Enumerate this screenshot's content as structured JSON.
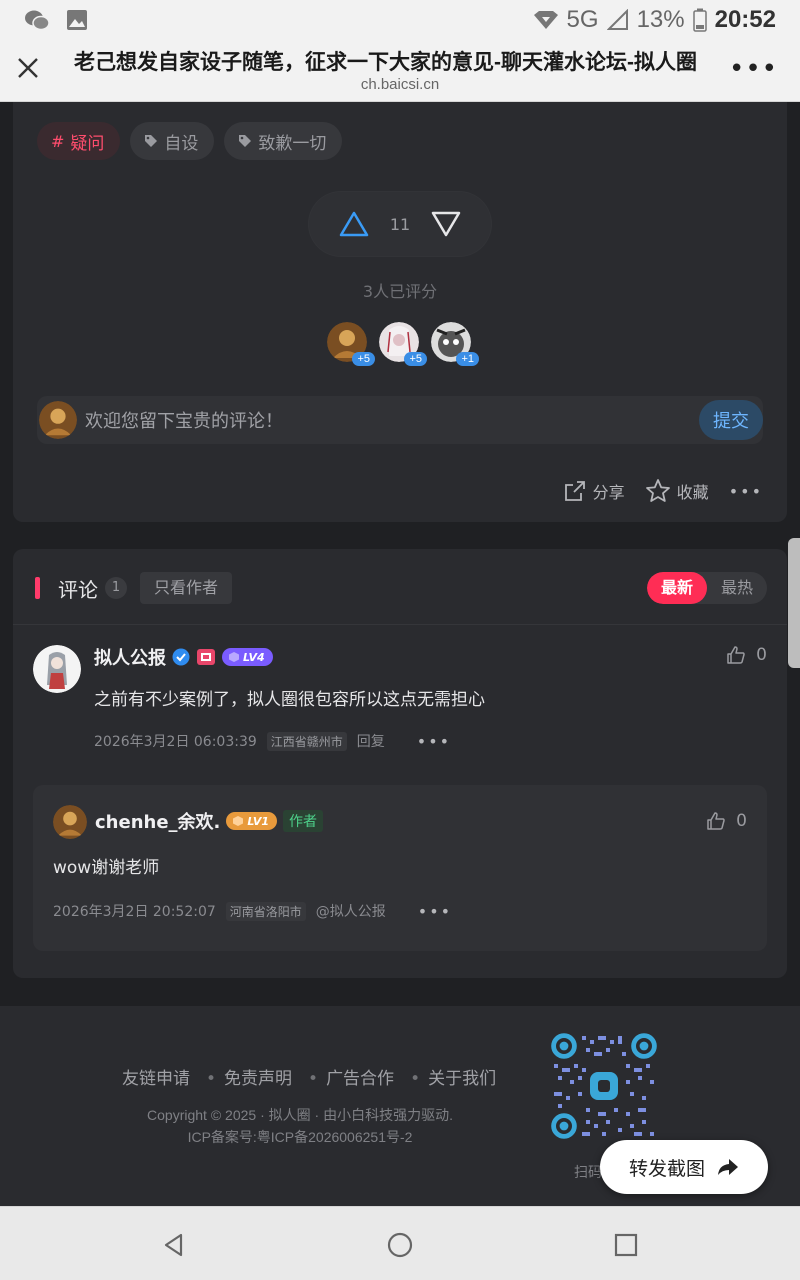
{
  "statusbar": {
    "network": "5G",
    "battery": "13%",
    "time": "20:52"
  },
  "browser": {
    "title": "老己想发自家设子随笔，征求一下大家的意见-聊天灌水论坛-拟人圈",
    "host": "ch.baicsi.cn"
  },
  "post": {
    "tags": [
      {
        "icon": "hash-icon",
        "label": "疑问",
        "color": "#ff4d6d"
      },
      {
        "icon": "tag-icon",
        "label": "自设"
      },
      {
        "icon": "tag-icon",
        "label": "致歉一切"
      }
    ],
    "vote_count": "11",
    "rated_text": "3人已评分",
    "raters": [
      {
        "badge": "+5",
        "color": "#c98a3a"
      },
      {
        "badge": "+5",
        "color": "#d8d0d4"
      },
      {
        "badge": "+1",
        "color": "#6a6a6a"
      }
    ],
    "comment_placeholder": "欢迎您留下宝贵的评论！",
    "submit_label": "提交",
    "share_label": "分享",
    "fav_label": "收藏"
  },
  "comments": {
    "title": "评论",
    "count": "1",
    "author_only": "只看作者",
    "sort_newest": "最新",
    "sort_hot": "最热",
    "main": {
      "username": "拟人公报",
      "level": "LV4",
      "likes": "0",
      "text": "之前有不少案例了，拟人圈很包容所以这点无需担心",
      "time": "2026年3月2日 06:03:39",
      "location": "江西省赣州市",
      "reply_label": "回复"
    },
    "reply": {
      "username": "chenhe_余欢.",
      "level": "LV1",
      "author_tag": "作者",
      "likes": "0",
      "text": "wow谢谢老师",
      "time": "2026年3月2日 20:52:07",
      "location": "河南省洛阳市",
      "mention": "@拟人公报"
    }
  },
  "footer": {
    "links": [
      "友链申请",
      "免责声明",
      "广告合作",
      "关于我们"
    ],
    "copyright": "Copyright © 2025 · 拟人圈 · 由小白科技强力驱动.",
    "icp": "ICP备案号:粤ICP备2026006251号-2",
    "scan_text": "扫码",
    "share_shot": "转发截图"
  }
}
